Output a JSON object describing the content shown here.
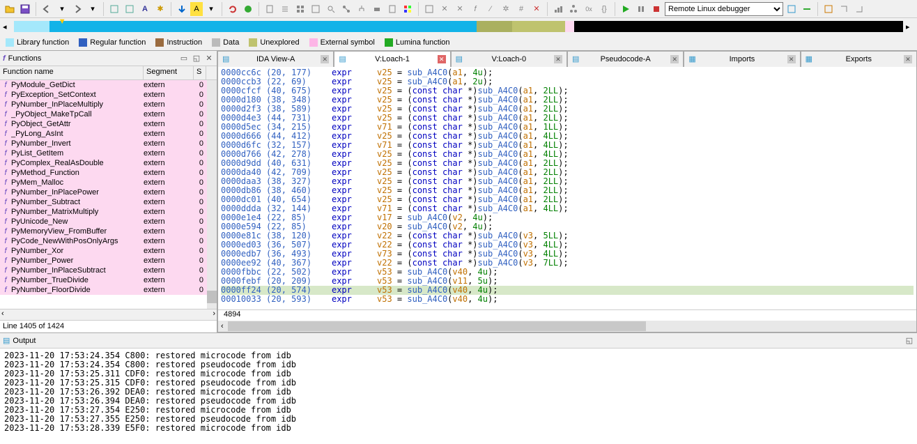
{
  "toolbar": {
    "debugger": "Remote Linux debugger"
  },
  "legend": {
    "lib": "Library function",
    "reg": "Regular function",
    "ins": "Instruction",
    "data": "Data",
    "unex": "Unexplored",
    "ext": "External symbol",
    "lum": "Lumina function"
  },
  "functions": {
    "title": "Functions",
    "headers": {
      "name": "Function name",
      "segment": "Segment",
      "s": "S"
    },
    "status": "Line 1405 of 1424",
    "rows": [
      {
        "name": "PyModule_GetDict",
        "seg": "extern",
        "s": "0",
        "pink": true
      },
      {
        "name": "PyException_SetContext",
        "seg": "extern",
        "s": "0",
        "pink": true
      },
      {
        "name": "PyNumber_InPlaceMultiply",
        "seg": "extern",
        "s": "0",
        "pink": true
      },
      {
        "name": "_PyObject_MakeTpCall",
        "seg": "extern",
        "s": "0",
        "pink": true
      },
      {
        "name": "PyObject_GetAttr",
        "seg": "extern",
        "s": "0",
        "pink": true
      },
      {
        "name": "_PyLong_AsInt",
        "seg": "extern",
        "s": "0",
        "pink": true
      },
      {
        "name": "PyNumber_Invert",
        "seg": "extern",
        "s": "0",
        "pink": true
      },
      {
        "name": "PyList_GetItem",
        "seg": "extern",
        "s": "0",
        "pink": true
      },
      {
        "name": "PyComplex_RealAsDouble",
        "seg": "extern",
        "s": "0",
        "pink": true
      },
      {
        "name": "PyMethod_Function",
        "seg": "extern",
        "s": "0",
        "pink": true
      },
      {
        "name": "PyMem_Malloc",
        "seg": "extern",
        "s": "0",
        "pink": true
      },
      {
        "name": "PyNumber_InPlacePower",
        "seg": "extern",
        "s": "0",
        "pink": true
      },
      {
        "name": "PyNumber_Subtract",
        "seg": "extern",
        "s": "0",
        "pink": true
      },
      {
        "name": "PyNumber_MatrixMultiply",
        "seg": "extern",
        "s": "0",
        "pink": true
      },
      {
        "name": "PyUnicode_New",
        "seg": "extern",
        "s": "0",
        "pink": true
      },
      {
        "name": "PyMemoryView_FromBuffer",
        "seg": "extern",
        "s": "0",
        "pink": true
      },
      {
        "name": "PyCode_NewWithPosOnlyArgs",
        "seg": "extern",
        "s": "0",
        "pink": true
      },
      {
        "name": "PyNumber_Xor",
        "seg": "extern",
        "s": "0",
        "pink": true
      },
      {
        "name": "PyNumber_Power",
        "seg": "extern",
        "s": "0",
        "pink": true
      },
      {
        "name": "PyNumber_InPlaceSubtract",
        "seg": "extern",
        "s": "0",
        "pink": true
      },
      {
        "name": "PyNumber_TrueDivide",
        "seg": "extern",
        "s": "0",
        "pink": true
      },
      {
        "name": "PyNumber_FloorDivide",
        "seg": "extern",
        "s": "0",
        "pink": true
      }
    ]
  },
  "tabs": [
    {
      "label": "IDA View-A",
      "active": false,
      "closeRed": false
    },
    {
      "label": "V:Loach-1",
      "active": true,
      "closeRed": true
    },
    {
      "label": "V:Loach-0",
      "active": false,
      "closeRed": false
    },
    {
      "label": "Pseudocode-A",
      "active": false,
      "closeRed": false
    },
    {
      "label": "Imports",
      "active": false,
      "closeRed": false
    },
    {
      "label": "Exports",
      "active": false,
      "closeRed": false
    }
  ],
  "content": {
    "status": "4894",
    "lines": [
      {
        "addr": "0000cc6c",
        "c": "(20, 177)",
        "k": "expr",
        "body": "v25 = sub_A4C0(a1, 4u);"
      },
      {
        "addr": "0000ccb3",
        "c": "(22, 69)",
        "k": "expr",
        "body": "v25 = sub_A4C0(a1, 2u);"
      },
      {
        "addr": "0000cfcf",
        "c": "(40, 675)",
        "k": "expr",
        "body": "v25 = (const char *)sub_A4C0(a1, 2LL);"
      },
      {
        "addr": "0000d180",
        "c": "(38, 348)",
        "k": "expr",
        "body": "v25 = (const char *)sub_A4C0(a1, 2LL);"
      },
      {
        "addr": "0000d2f3",
        "c": "(38, 589)",
        "k": "expr",
        "body": "v25 = (const char *)sub_A4C0(a1, 2LL);"
      },
      {
        "addr": "0000d4e3",
        "c": "(44, 731)",
        "k": "expr",
        "body": "v25 = (const char *)sub_A4C0(a1, 2LL);"
      },
      {
        "addr": "0000d5ec",
        "c": "(34, 215)",
        "k": "expr",
        "body": "v71 = (const char *)sub_A4C0(a1, 1LL);"
      },
      {
        "addr": "0000d666",
        "c": "(44, 412)",
        "k": "expr",
        "body": "v25 = (const char *)sub_A4C0(a1, 4LL);"
      },
      {
        "addr": "0000d6fc",
        "c": "(32, 157)",
        "k": "expr",
        "body": "v71 = (const char *)sub_A4C0(a1, 4LL);"
      },
      {
        "addr": "0000d766",
        "c": "(42, 278)",
        "k": "expr",
        "body": "v25 = (const char *)sub_A4C0(a1, 4LL);"
      },
      {
        "addr": "0000d9dd",
        "c": "(40, 631)",
        "k": "expr",
        "body": "v25 = (const char *)sub_A4C0(a1, 2LL);"
      },
      {
        "addr": "0000da40",
        "c": "(42, 709)",
        "k": "expr",
        "body": "v25 = (const char *)sub_A4C0(a1, 2LL);"
      },
      {
        "addr": "0000daa3",
        "c": "(38, 327)",
        "k": "expr",
        "body": "v25 = (const char *)sub_A4C0(a1, 2LL);"
      },
      {
        "addr": "0000db86",
        "c": "(38, 460)",
        "k": "expr",
        "body": "v25 = (const char *)sub_A4C0(a1, 2LL);"
      },
      {
        "addr": "0000dc01",
        "c": "(40, 654)",
        "k": "expr",
        "body": "v25 = (const char *)sub_A4C0(a1, 2LL);"
      },
      {
        "addr": "0000ddda",
        "c": "(32, 144)",
        "k": "expr",
        "body": "v71 = (const char *)sub_A4C0(a1, 4LL);"
      },
      {
        "addr": "0000e1e4",
        "c": "(22, 85)",
        "k": "expr",
        "body": "v17 = sub_A4C0(v2, 4u);"
      },
      {
        "addr": "0000e594",
        "c": "(22, 85)",
        "k": "expr",
        "body": "v20 = sub_A4C0(v2, 4u);"
      },
      {
        "addr": "0000e81c",
        "c": "(38, 120)",
        "k": "expr",
        "body": "v22 = (const char *)sub_A4C0(v3, 5LL);"
      },
      {
        "addr": "0000ed03",
        "c": "(36, 507)",
        "k": "expr",
        "body": "v22 = (const char *)sub_A4C0(v3, 4LL);"
      },
      {
        "addr": "0000edb7",
        "c": "(36, 493)",
        "k": "expr",
        "body": "v73 = (const char *)sub_A4C0(v3, 4LL);"
      },
      {
        "addr": "0000ee92",
        "c": "(40, 367)",
        "k": "expr",
        "body": "v22 = (const char *)sub_A4C0(v3, 7LL);"
      },
      {
        "addr": "0000fbbc",
        "c": "(22, 502)",
        "k": "expr",
        "body": "v53 = sub_A4C0(v40, 4u);"
      },
      {
        "addr": "0000febf",
        "c": "(20, 209)",
        "k": "expr",
        "body": "v53 = sub_A4C0(v11, 5u);"
      },
      {
        "addr": "0000ff24",
        "c": "(20, 574)",
        "k": "expr",
        "body": "v53 = sub_A4C0(v40, 4u);",
        "hl": true
      },
      {
        "addr": "00010033",
        "c": "(20, 593)",
        "k": "expr",
        "body": "v53 = sub_A4C0(v40, 4u);",
        "cut": true
      }
    ]
  },
  "output": {
    "title": "Output",
    "lines": [
      "2023-11-20 17:53:24.354 C800: restored microcode from idb",
      "2023-11-20 17:53:24.354 C800: restored pseudocode from idb",
      "2023-11-20 17:53:25.311 CDF0: restored microcode from idb",
      "2023-11-20 17:53:25.315 CDF0: restored pseudocode from idb",
      "2023-11-20 17:53:26.392 DEA0: restored microcode from idb",
      "2023-11-20 17:53:26.394 DEA0: restored pseudocode from idb",
      "2023-11-20 17:53:27.354 E250: restored microcode from idb",
      "2023-11-20 17:53:27.355 E250: restored pseudocode from idb",
      "2023-11-20 17:53:28.339 E5F0: restored microcode from idb"
    ]
  }
}
